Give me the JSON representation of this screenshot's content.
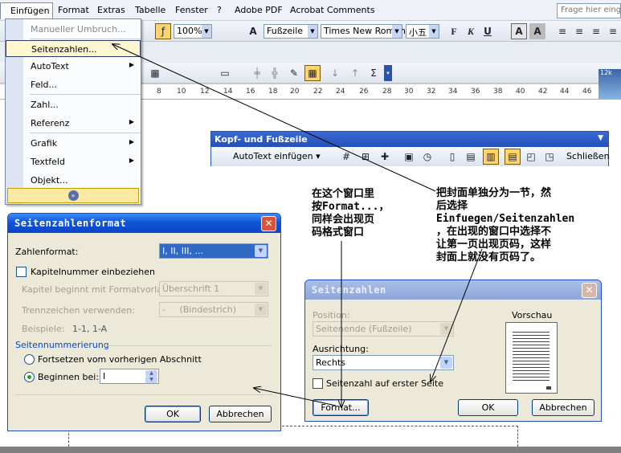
{
  "menubar": {
    "items": [
      "Einfügen",
      "Format",
      "Extras",
      "Tabelle",
      "Fenster",
      "?",
      "Adobe PDF",
      "Acrobat Comments"
    ],
    "help_placeholder": "Frage hier eingeben"
  },
  "toolbar": {
    "zoom": "100%",
    "style": "Fußzeile",
    "font": "Times New Roman",
    "size": "小五",
    "bold": "F",
    "italic": "K",
    "underline": "U",
    "a_letter": "A",
    "sum_sign": "Σ"
  },
  "ruler": {
    "ticks": [
      "8",
      "10",
      "12",
      "14",
      "16",
      "18",
      "20",
      "22",
      "24",
      "26",
      "28",
      "30",
      "32",
      "34",
      "36",
      "38",
      "40",
      "42",
      "44",
      "46"
    ]
  },
  "menu": {
    "items": [
      {
        "label": "Manueller Umbruch...",
        "disabled": true
      },
      {
        "label": "Seitenzahlen...",
        "highlighted": true
      },
      {
        "label": "AutoText",
        "submenu": true
      },
      {
        "label": "Feld..."
      },
      {
        "label": "Zahl..."
      },
      {
        "label": "Referenz",
        "submenu": true
      },
      {
        "label": "Grafik",
        "submenu": true
      },
      {
        "label": "Textfeld",
        "submenu": true
      },
      {
        "label": "Objekt..."
      }
    ]
  },
  "kopf": {
    "title": "Kopf- und Fußzeile",
    "autotext": "AutoText einfügen ▾",
    "close": "Schließen"
  },
  "thumb": {
    "label": "12k"
  },
  "format_dialog": {
    "title": "Seitenzahlenformat",
    "zahlenformat_label": "Zahlenformat:",
    "zahlenformat_value": "I, II, III, ...",
    "kapitel_label": "Kapitelnummer einbeziehen",
    "kapitel_beginnt_label": "Kapitel beginnt mit Formatvorlage:",
    "kapitel_beginnt_value": "Überschrift 1",
    "trennzeichen_label": "Trennzeichen verwenden:",
    "trennzeichen_value": "-     (Bindestrich)",
    "beispiele_label": "Beispiele:",
    "beispiele_value": "1-1, 1-A",
    "group_label": "Seitennummerierung",
    "fortsetzen_label": "Fortsetzen vom vorherigen Abschnitt",
    "beginnen_label": "Beginnen bei:",
    "beginnen_value": "I",
    "ok": "OK",
    "cancel": "Abbrechen"
  },
  "seiten_dialog": {
    "title": "Seitenzahlen",
    "position_label": "Position:",
    "position_value": "Seitenende (Fußzeile)",
    "ausrichtung_label": "Ausrichtung:",
    "ausrichtung_value": "Rechts",
    "checkbox_label": "Seitenzahl auf erster Seite",
    "vorschau_label": "Vorschau",
    "format_btn": "Format...",
    "ok": "OK",
    "cancel": "Abbrechen"
  },
  "annotations": {
    "note1": "在这个窗口里\n按Format...，\n同样会出现页\n码格式窗口",
    "note2": "把封面单独分为一节，然\n后选择\nEinfuegen/Seitenzahlen\n，在出现的窗口中选择不\n让第一页出现页码，这样\n封面上就没有页码了。"
  }
}
